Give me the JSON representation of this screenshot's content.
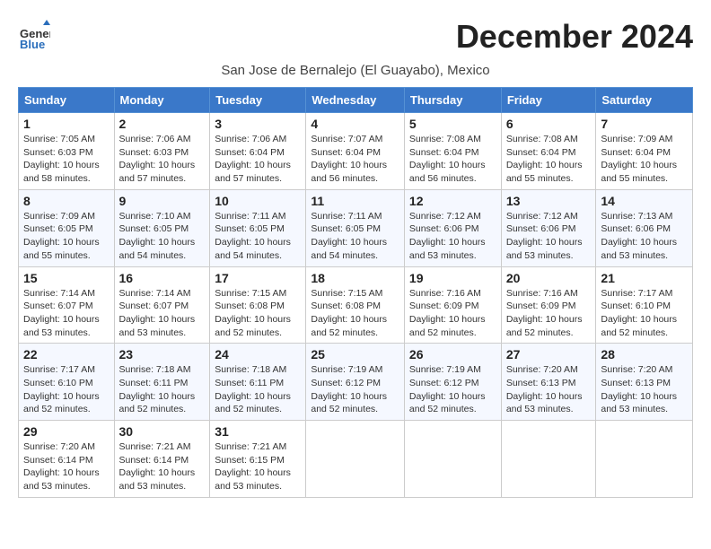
{
  "header": {
    "logo_general": "General",
    "logo_blue": "Blue",
    "month_title": "December 2024",
    "subtitle": "San Jose de Bernalejo (El Guayabo), Mexico"
  },
  "weekdays": [
    "Sunday",
    "Monday",
    "Tuesday",
    "Wednesday",
    "Thursday",
    "Friday",
    "Saturday"
  ],
  "weeks": [
    [
      {
        "day": "1",
        "info": "Sunrise: 7:05 AM\nSunset: 6:03 PM\nDaylight: 10 hours\nand 58 minutes."
      },
      {
        "day": "2",
        "info": "Sunrise: 7:06 AM\nSunset: 6:03 PM\nDaylight: 10 hours\nand 57 minutes."
      },
      {
        "day": "3",
        "info": "Sunrise: 7:06 AM\nSunset: 6:04 PM\nDaylight: 10 hours\nand 57 minutes."
      },
      {
        "day": "4",
        "info": "Sunrise: 7:07 AM\nSunset: 6:04 PM\nDaylight: 10 hours\nand 56 minutes."
      },
      {
        "day": "5",
        "info": "Sunrise: 7:08 AM\nSunset: 6:04 PM\nDaylight: 10 hours\nand 56 minutes."
      },
      {
        "day": "6",
        "info": "Sunrise: 7:08 AM\nSunset: 6:04 PM\nDaylight: 10 hours\nand 55 minutes."
      },
      {
        "day": "7",
        "info": "Sunrise: 7:09 AM\nSunset: 6:04 PM\nDaylight: 10 hours\nand 55 minutes."
      }
    ],
    [
      {
        "day": "8",
        "info": "Sunrise: 7:09 AM\nSunset: 6:05 PM\nDaylight: 10 hours\nand 55 minutes."
      },
      {
        "day": "9",
        "info": "Sunrise: 7:10 AM\nSunset: 6:05 PM\nDaylight: 10 hours\nand 54 minutes."
      },
      {
        "day": "10",
        "info": "Sunrise: 7:11 AM\nSunset: 6:05 PM\nDaylight: 10 hours\nand 54 minutes."
      },
      {
        "day": "11",
        "info": "Sunrise: 7:11 AM\nSunset: 6:05 PM\nDaylight: 10 hours\nand 54 minutes."
      },
      {
        "day": "12",
        "info": "Sunrise: 7:12 AM\nSunset: 6:06 PM\nDaylight: 10 hours\nand 53 minutes."
      },
      {
        "day": "13",
        "info": "Sunrise: 7:12 AM\nSunset: 6:06 PM\nDaylight: 10 hours\nand 53 minutes."
      },
      {
        "day": "14",
        "info": "Sunrise: 7:13 AM\nSunset: 6:06 PM\nDaylight: 10 hours\nand 53 minutes."
      }
    ],
    [
      {
        "day": "15",
        "info": "Sunrise: 7:14 AM\nSunset: 6:07 PM\nDaylight: 10 hours\nand 53 minutes."
      },
      {
        "day": "16",
        "info": "Sunrise: 7:14 AM\nSunset: 6:07 PM\nDaylight: 10 hours\nand 53 minutes."
      },
      {
        "day": "17",
        "info": "Sunrise: 7:15 AM\nSunset: 6:08 PM\nDaylight: 10 hours\nand 52 minutes."
      },
      {
        "day": "18",
        "info": "Sunrise: 7:15 AM\nSunset: 6:08 PM\nDaylight: 10 hours\nand 52 minutes."
      },
      {
        "day": "19",
        "info": "Sunrise: 7:16 AM\nSunset: 6:09 PM\nDaylight: 10 hours\nand 52 minutes."
      },
      {
        "day": "20",
        "info": "Sunrise: 7:16 AM\nSunset: 6:09 PM\nDaylight: 10 hours\nand 52 minutes."
      },
      {
        "day": "21",
        "info": "Sunrise: 7:17 AM\nSunset: 6:10 PM\nDaylight: 10 hours\nand 52 minutes."
      }
    ],
    [
      {
        "day": "22",
        "info": "Sunrise: 7:17 AM\nSunset: 6:10 PM\nDaylight: 10 hours\nand 52 minutes."
      },
      {
        "day": "23",
        "info": "Sunrise: 7:18 AM\nSunset: 6:11 PM\nDaylight: 10 hours\nand 52 minutes."
      },
      {
        "day": "24",
        "info": "Sunrise: 7:18 AM\nSunset: 6:11 PM\nDaylight: 10 hours\nand 52 minutes."
      },
      {
        "day": "25",
        "info": "Sunrise: 7:19 AM\nSunset: 6:12 PM\nDaylight: 10 hours\nand 52 minutes."
      },
      {
        "day": "26",
        "info": "Sunrise: 7:19 AM\nSunset: 6:12 PM\nDaylight: 10 hours\nand 52 minutes."
      },
      {
        "day": "27",
        "info": "Sunrise: 7:20 AM\nSunset: 6:13 PM\nDaylight: 10 hours\nand 53 minutes."
      },
      {
        "day": "28",
        "info": "Sunrise: 7:20 AM\nSunset: 6:13 PM\nDaylight: 10 hours\nand 53 minutes."
      }
    ],
    [
      {
        "day": "29",
        "info": "Sunrise: 7:20 AM\nSunset: 6:14 PM\nDaylight: 10 hours\nand 53 minutes."
      },
      {
        "day": "30",
        "info": "Sunrise: 7:21 AM\nSunset: 6:14 PM\nDaylight: 10 hours\nand 53 minutes."
      },
      {
        "day": "31",
        "info": "Sunrise: 7:21 AM\nSunset: 6:15 PM\nDaylight: 10 hours\nand 53 minutes."
      },
      {
        "day": "",
        "info": ""
      },
      {
        "day": "",
        "info": ""
      },
      {
        "day": "",
        "info": ""
      },
      {
        "day": "",
        "info": ""
      }
    ]
  ]
}
